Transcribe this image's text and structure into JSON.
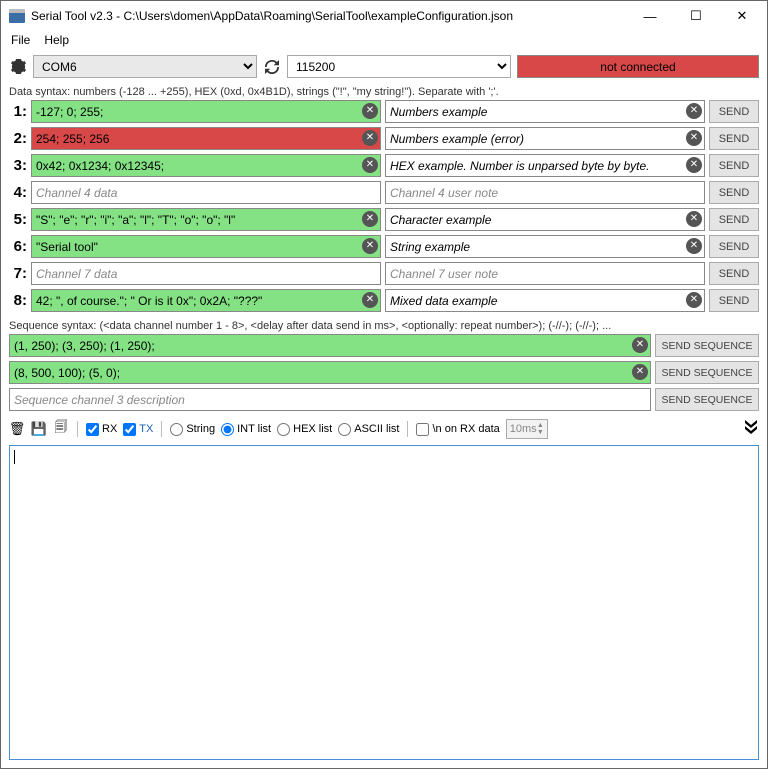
{
  "window": {
    "title": "Serial Tool v2.3 - C:\\Users\\domen\\AppData\\Roaming\\SerialTool\\exampleConfiguration.json"
  },
  "menu": {
    "file": "File",
    "help": "Help"
  },
  "toolbar": {
    "port": "COM6",
    "baud": "115200",
    "status": "not connected"
  },
  "data_syntax_hint": "Data syntax: numbers (-128 ... +255), HEX (0xd, 0x4B1D), strings (\"!\", \"my string!\"). Separate with ';'.",
  "channels": [
    {
      "num": "1:",
      "data": "-127; 0; 255;",
      "note": "Numbers example",
      "state": "ok"
    },
    {
      "num": "2:",
      "data": "254; 255; 256",
      "note": "Numbers example (error)",
      "state": "err"
    },
    {
      "num": "3:",
      "data": "0x42; 0x1234; 0x12345;",
      "note": "HEX example. Number is unparsed byte by byte.",
      "state": "ok"
    },
    {
      "num": "4:",
      "data": "",
      "placeholder": "Channel 4 data",
      "note": "",
      "note_placeholder": "Channel 4 user note",
      "state": "empty"
    },
    {
      "num": "5:",
      "data": "\"S\"; \"e\"; \"r\"; \"i\"; \"a\"; \"l\"; \"T\"; \"o\"; \"o\"; \"l\"",
      "note": "Character example",
      "state": "ok"
    },
    {
      "num": "6:",
      "data": "\"Serial tool\"",
      "note": "String example",
      "state": "ok"
    },
    {
      "num": "7:",
      "data": "",
      "placeholder": "Channel 7 data",
      "note": "",
      "note_placeholder": "Channel 7 user note",
      "state": "empty"
    },
    {
      "num": "8:",
      "data": "42; \", of course.\"; \" Or is it 0x\"; 0x2A; \"???\"",
      "note": "Mixed data example",
      "state": "ok"
    }
  ],
  "send_label": "SEND",
  "seq_syntax_hint": "Sequence syntax: (<data channel number 1 - 8>, <delay after data send in ms>, <optionally: repeat number>); (-//-); (-//-); ...",
  "sequences": [
    {
      "data": "(1, 250); (3, 250); (1, 250);",
      "state": "ok"
    },
    {
      "data": "(8, 500, 100); (5, 0);",
      "state": "ok"
    },
    {
      "data": "",
      "placeholder": "Sequence channel 3 description",
      "state": "empty"
    }
  ],
  "send_seq_label": "SEND SEQUENCE",
  "log": {
    "rx": "RX",
    "tx": "TX",
    "fmt_string": "String",
    "fmt_int": "INT list",
    "fmt_hex": "HEX list",
    "fmt_ascii": "ASCII list",
    "newline_rx": "\\n on RX data",
    "interval": "10ms"
  }
}
